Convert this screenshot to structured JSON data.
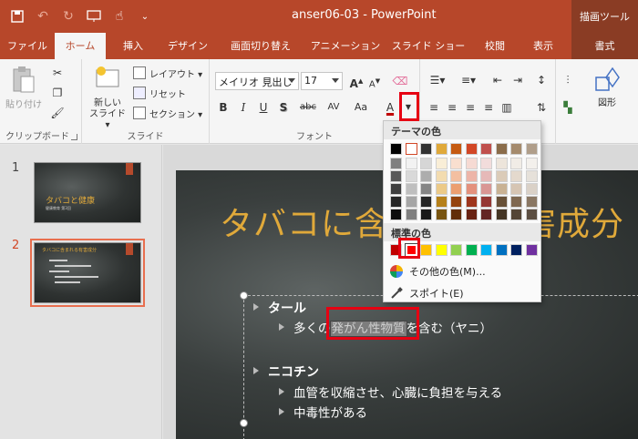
{
  "titlebar": {
    "doc_title": "anser06-03 - PowerPoint",
    "context_header": "描画ツール"
  },
  "tabs": [
    {
      "label": "ファイル"
    },
    {
      "label": "ホーム"
    },
    {
      "label": "挿入"
    },
    {
      "label": "デザイン"
    },
    {
      "label": "画面切り替え"
    },
    {
      "label": "アニメーション"
    },
    {
      "label": "スライド ショー"
    },
    {
      "label": "校閲"
    },
    {
      "label": "表示"
    },
    {
      "label": "書式"
    }
  ],
  "ribbon": {
    "clipboard": {
      "paste": "貼り付け",
      "group": "クリップボード"
    },
    "slides": {
      "new_slide_1": "新しい",
      "new_slide_2": "スライド ▾",
      "layout": "レイアウト ▾",
      "reset": "リセット",
      "section": "セクション ▾",
      "group": "スライド"
    },
    "font": {
      "font_name": "メイリオ 見出し",
      "font_size": "17",
      "group": "フォント",
      "bold": "B",
      "italic": "I",
      "underline": "U",
      "shadow": "S",
      "strike": "abc",
      "spacing": "AV",
      "case": "Aa",
      "font_color": "A"
    },
    "drawing": {
      "shape": "図形"
    }
  },
  "thumbnails": [
    {
      "num": "1",
      "title": "タバコと健康",
      "subtitle": "健康教育 第3回"
    },
    {
      "num": "2",
      "title": "タバコに含まれる有害成分"
    }
  ],
  "slide": {
    "title": "タバコに含まれる有害成分",
    "bullets": [
      {
        "text": "タール"
      },
      {
        "pre": "多くの",
        "hl": "発がん性物質",
        "post": "を含む（ヤニ）"
      },
      {
        "text": "ニコチン"
      },
      {
        "text": "血管を収縮させ、心臓に負担を与える"
      },
      {
        "text": "中毒性がある"
      }
    ]
  },
  "color_menu": {
    "theme_header": "テーマの色",
    "standard_header": "標準の色",
    "more_colors": "その他の色(M)...",
    "eyedropper": "スポイト(E)",
    "theme_columns": [
      [
        "#000000",
        "#7f7f7f",
        "#595959",
        "#3f3f3f",
        "#262626",
        "#0d0d0d"
      ],
      [
        "#ffffff",
        "#f2f2f2",
        "#d9d9d9",
        "#bfbfbf",
        "#a6a6a6",
        "#808080"
      ],
      [
        "#323232",
        "#d6d6d6",
        "#adadad",
        "#858585",
        "#262626",
        "#191919"
      ],
      [
        "#e0a93a",
        "#f9eed7",
        "#f3dcb0",
        "#ecca88",
        "#b6801a",
        "#795511"
      ],
      [
        "#c55a11",
        "#f9dfcf",
        "#f3bfa0",
        "#ec9f70",
        "#94430d",
        "#622d09"
      ],
      [
        "#d24726",
        "#f6dad3",
        "#edb5a8",
        "#e4917d",
        "#9e351c",
        "#692313"
      ],
      [
        "#c0504d",
        "#f2dcdb",
        "#e6b9b8",
        "#d99694",
        "#953734",
        "#632523"
      ],
      [
        "#8a6c4a",
        "#ede5db",
        "#dbcbb8",
        "#c9b294",
        "#685138",
        "#453625"
      ],
      [
        "#a58b6d",
        "#f1ece6",
        "#e4d9cd",
        "#d6c5b3",
        "#7f6850",
        "#544535"
      ],
      [
        "#b09e8a",
        "#f3f0ec",
        "#e6e1da",
        "#dad1c7",
        "#8a7763",
        "#5c4f42"
      ]
    ],
    "standard": [
      "#c00000",
      "#ff0000",
      "#ffc000",
      "#ffff00",
      "#92d050",
      "#00b050",
      "#00b0f0",
      "#0070c0",
      "#002060",
      "#7030a0"
    ]
  }
}
